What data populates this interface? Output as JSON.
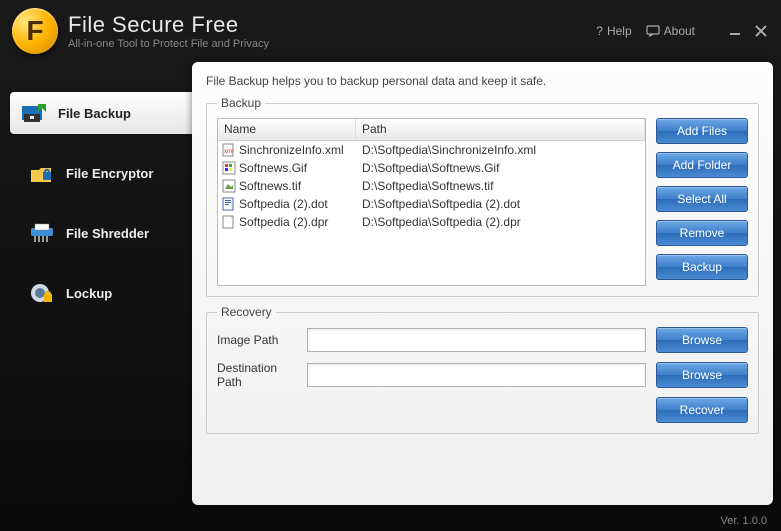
{
  "header": {
    "app_title": "File Secure Free",
    "subtitle": "All-in-one Tool to Protect File and Privacy",
    "help": "Help",
    "about": "About"
  },
  "sidebar": {
    "items": [
      {
        "label": "File Backup"
      },
      {
        "label": "File Encryptor"
      },
      {
        "label": "File Shredder"
      },
      {
        "label": "Lockup"
      }
    ]
  },
  "main": {
    "description": "File Backup helps you to backup personal data and keep it safe.",
    "backup": {
      "legend": "Backup",
      "columns": {
        "name": "Name",
        "path": "Path"
      },
      "rows": [
        {
          "name": "SinchronizeInfo.xml",
          "path": "D:\\Softpedia\\SinchronizeInfo.xml",
          "icon": "xml"
        },
        {
          "name": "Softnews.Gif",
          "path": "D:\\Softpedia\\Softnews.Gif",
          "icon": "gif"
        },
        {
          "name": "Softnews.tif",
          "path": "D:\\Softpedia\\Softnews.tif",
          "icon": "tif"
        },
        {
          "name": "Softpedia (2).dot",
          "path": "D:\\Softpedia\\Softpedia (2).dot",
          "icon": "dot"
        },
        {
          "name": "Softpedia (2).dpr",
          "path": "D:\\Softpedia\\Softpedia (2).dpr",
          "icon": "dpr"
        }
      ],
      "buttons": {
        "add_files": "Add Files",
        "add_folder": "Add Folder",
        "select_all": "Select All",
        "remove": "Remove",
        "backup": "Backup"
      }
    },
    "recovery": {
      "legend": "Recovery",
      "image_path_label": "Image Path",
      "image_path_value": "",
      "dest_path_label": "Destination Path",
      "dest_path_value": "",
      "browse": "Browse",
      "recover": "Recover"
    }
  },
  "footer": {
    "version": "Ver. 1.0.0"
  }
}
